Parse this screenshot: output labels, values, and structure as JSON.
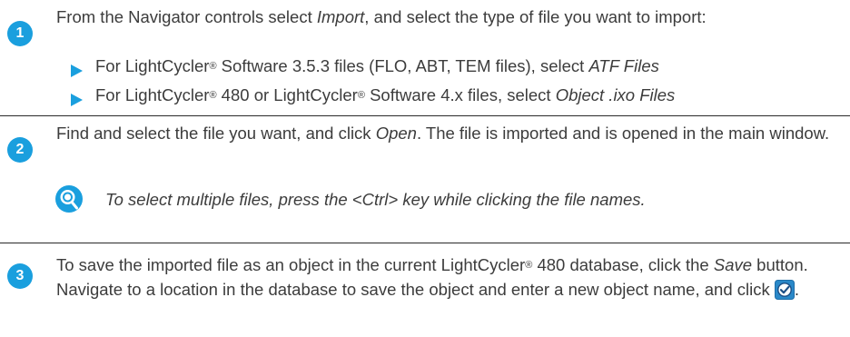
{
  "colors": {
    "accent": "#1a9fde",
    "text": "#3c3c3c",
    "rule": "#2a2a2a"
  },
  "steps": [
    {
      "number": "1",
      "text_a": "From the Navigator controls select ",
      "text_b": "Import",
      "text_c": ", and select the type of file you want to import:",
      "bullets": [
        {
          "a": "For LightCycler",
          "sup": "®",
          "b": " Software 3.5.3 files (FLO, ABT, TEM files), select ",
          "em": "ATF Files"
        },
        {
          "a": "For LightCycler",
          "sup1": "®",
          "b": " 480 or LightCycler",
          "sup2": "®",
          "c": " Software 4.x files, select ",
          "em": "Object .ixo Files"
        }
      ]
    },
    {
      "number": "2",
      "text_a": "Find and select the file you want, and click ",
      "text_b": "Open",
      "text_c": ". The file is imported and is opened in the main window.",
      "hint_icon": "magnifier-hint-icon",
      "hint": "To select multiple files, press the <Ctrl> key while clicking the file names."
    },
    {
      "number": "3",
      "text_a": "To save the imported file as an object in the current LightCycler",
      "sup": "®",
      "text_b": " 480 database, click the ",
      "text_c": "Save",
      "text_d": " button. Navigate to a location in the database to save the object and enter a new object name, and click ",
      "button_icon": "checkmark-button-icon"
    }
  ]
}
